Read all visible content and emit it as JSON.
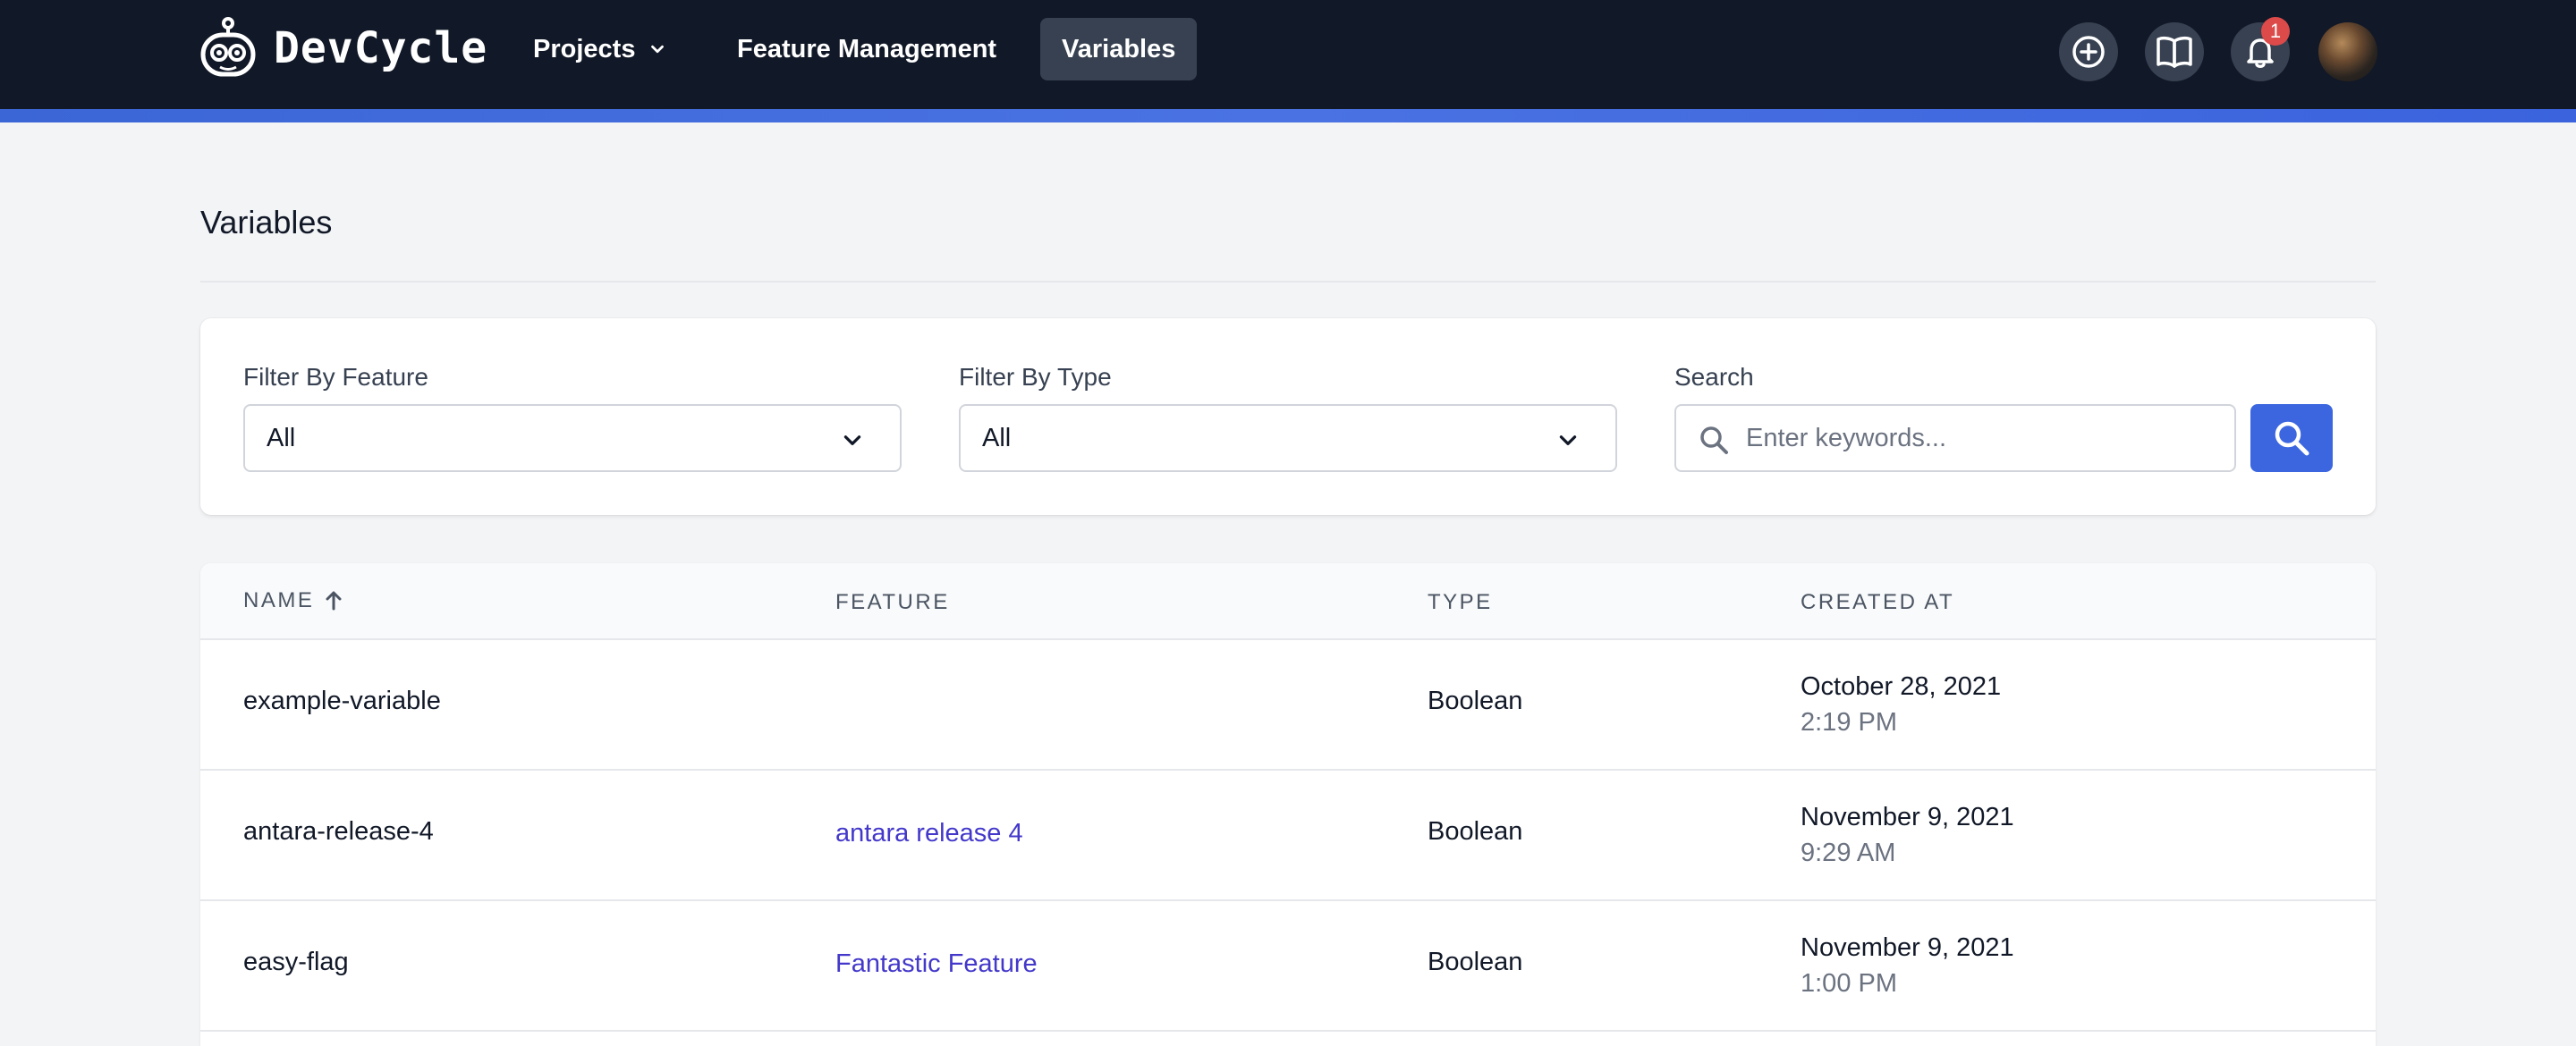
{
  "nav": {
    "brand": "DevCycle",
    "items": [
      {
        "label": "Projects"
      },
      {
        "label": "Feature Management"
      },
      {
        "label": "Variables"
      }
    ],
    "notification_count": "1"
  },
  "page": {
    "title": "Variables"
  },
  "filters": {
    "feature": {
      "label": "Filter By Feature",
      "value": "All"
    },
    "type": {
      "label": "Filter By Type",
      "value": "All"
    },
    "search": {
      "label": "Search",
      "placeholder": "Enter keywords..."
    }
  },
  "table": {
    "columns": [
      "NAME",
      "FEATURE",
      "TYPE",
      "CREATED AT"
    ],
    "sort": {
      "column": "NAME",
      "direction": "ascending"
    },
    "rows": [
      {
        "name": "example-variable",
        "feature": "",
        "type": "Boolean",
        "date": "October 28, 2021",
        "time": "2:19 PM"
      },
      {
        "name": "antara-release-4",
        "feature": "antara release 4",
        "type": "Boolean",
        "date": "November 9, 2021",
        "time": "9:29 AM"
      },
      {
        "name": "easy-flag",
        "feature": "Fantastic Feature",
        "type": "Boolean",
        "date": "November 9, 2021",
        "time": "1:00 PM"
      }
    ]
  },
  "colors": {
    "nav_bg": "#111827",
    "accent": "#3b66e0",
    "link": "#4338ca",
    "badge": "#dc4a4a"
  },
  "icons": [
    "devcycle-logo-icon",
    "chevron-down-icon",
    "plus-circle-icon",
    "book-icon",
    "bell-icon",
    "search-icon",
    "arrow-up-icon"
  ]
}
